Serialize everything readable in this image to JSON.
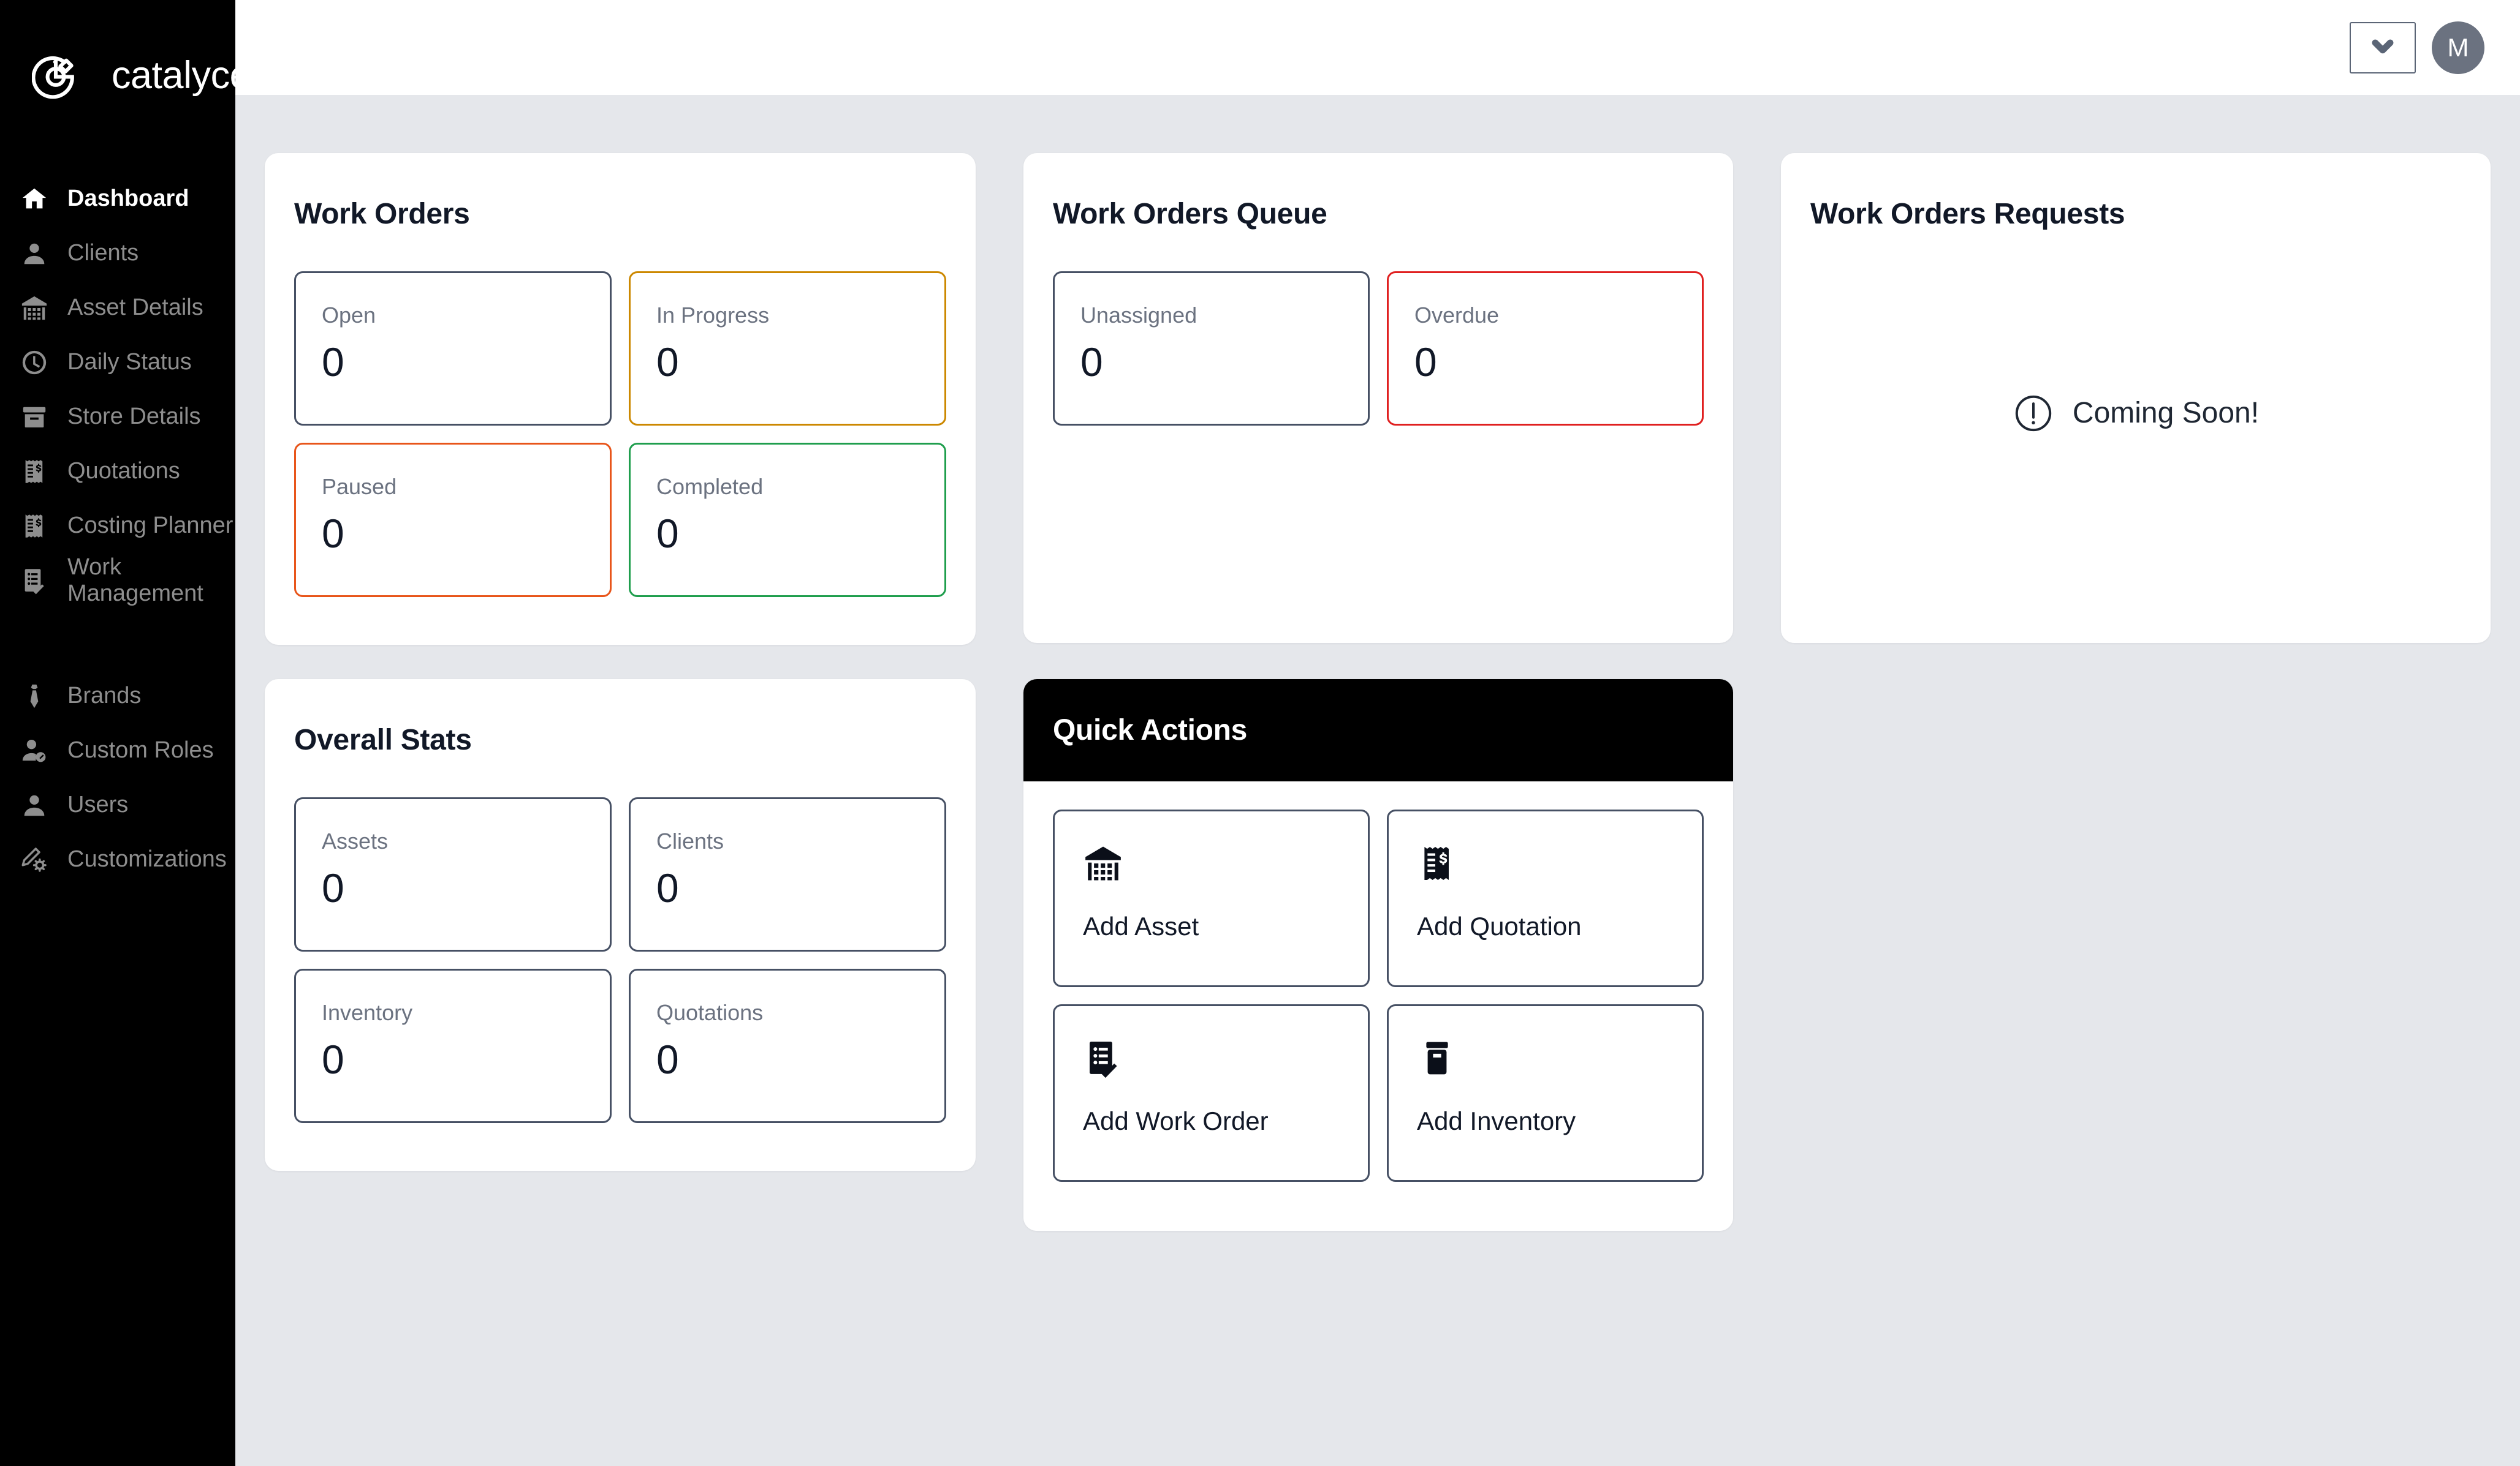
{
  "brand": {
    "name": "catalyces",
    "logo_icon": "catalyces-pie-edit-logo"
  },
  "sidebar": {
    "primary_items": [
      {
        "label": "Dashboard",
        "icon": "home-icon",
        "active": true
      },
      {
        "label": "Clients",
        "icon": "person-icon",
        "active": false
      },
      {
        "label": "Asset Details",
        "icon": "warehouse-icon",
        "active": false
      },
      {
        "label": "Daily Status",
        "icon": "clock-icon",
        "active": false
      },
      {
        "label": "Store Details",
        "icon": "archive-box-icon",
        "active": false
      },
      {
        "label": "Quotations",
        "icon": "receipt-dollar-icon",
        "active": false
      },
      {
        "label": "Costing Planner",
        "icon": "receipt-dollar-icon",
        "active": false
      },
      {
        "label": "Work Management",
        "icon": "checklist-icon",
        "active": false
      }
    ],
    "secondary_items": [
      {
        "label": "Brands",
        "icon": "tie-icon",
        "active": false
      },
      {
        "label": "Custom Roles",
        "icon": "person-edit-icon",
        "active": false
      },
      {
        "label": "Users",
        "icon": "person-icon",
        "active": false
      },
      {
        "label": "Customizations",
        "icon": "pencil-gear-icon",
        "active": false
      }
    ]
  },
  "topbar": {
    "select_value": "",
    "select_icon": "chevron-down-icon",
    "avatar_initial": "M"
  },
  "work_orders": {
    "title": "Work Orders",
    "tiles": [
      {
        "label": "Open",
        "value": "0",
        "accent": "slate",
        "color": "#465064"
      },
      {
        "label": "In Progress",
        "value": "0",
        "accent": "amber",
        "color": "#cc8800"
      },
      {
        "label": "Paused",
        "value": "0",
        "accent": "orange",
        "color": "#e8551a"
      },
      {
        "label": "Completed",
        "value": "0",
        "accent": "green",
        "color": "#1f9e4d"
      }
    ]
  },
  "work_orders_queue": {
    "title": "Work Orders Queue",
    "tiles": [
      {
        "label": "Unassigned",
        "value": "0",
        "accent": "slate",
        "color": "#465064"
      },
      {
        "label": "Overdue",
        "value": "0",
        "accent": "red",
        "color": "#e02020"
      }
    ]
  },
  "work_orders_requests": {
    "title": "Work Orders Requests",
    "empty_icon": "exclamation-circle-icon",
    "empty_text": "Coming Soon!"
  },
  "overall_stats": {
    "title": "Overall Stats",
    "tiles": [
      {
        "label": "Assets",
        "value": "0",
        "accent": "slate",
        "color": "#465064"
      },
      {
        "label": "Clients",
        "value": "0",
        "accent": "slate",
        "color": "#465064"
      },
      {
        "label": "Inventory",
        "value": "0",
        "accent": "slate",
        "color": "#465064"
      },
      {
        "label": "Quotations",
        "value": "0",
        "accent": "slate",
        "color": "#465064"
      }
    ]
  },
  "quick_actions": {
    "title": "Quick Actions",
    "items": [
      {
        "label": "Add Asset",
        "icon": "warehouse-icon"
      },
      {
        "label": "Add Quotation",
        "icon": "receipt-dollar-icon"
      },
      {
        "label": "Add Work Order",
        "icon": "checklist-check-icon"
      },
      {
        "label": "Add Inventory",
        "icon": "inventory-box-icon"
      }
    ]
  },
  "theme": {
    "sidebar_bg": "#000000",
    "page_bg": "#e5e7eb",
    "card_bg": "#ffffff",
    "slate": "#465064",
    "muted_text": "#6b7280"
  }
}
